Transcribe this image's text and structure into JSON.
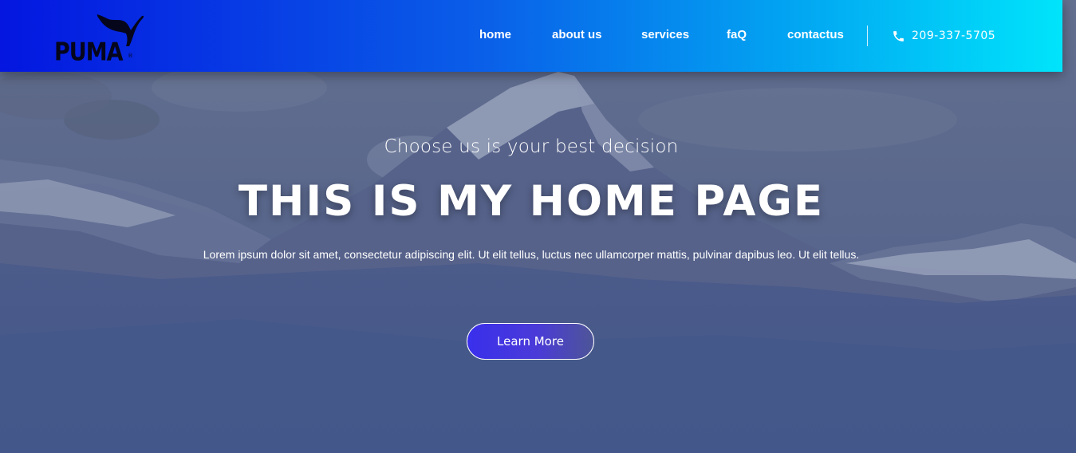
{
  "header": {
    "logo_text": "PUMA",
    "nav": [
      {
        "label": "home"
      },
      {
        "label": "about us"
      },
      {
        "label": "services"
      },
      {
        "label": "faQ"
      },
      {
        "label": "contactus"
      }
    ],
    "phone": {
      "icon": "phone-icon",
      "number": "209-337-5705"
    }
  },
  "hero": {
    "subtitle": "Choose us is your best decision",
    "title": "THIS IS MY HOME PAGE",
    "description": "Lorem ipsum dolor sit amet, consectetur adipiscing elit. Ut elit tellus, luctus nec ullamcorper mattis, pulvinar dapibus leo. Ut elit tellus.",
    "cta_label": "Learn More"
  },
  "colors": {
    "header_gradient_start": "#0416e0",
    "header_gradient_end": "#00e4fb",
    "hero_overlay": "#445888",
    "button_fill": "#3a2fec"
  }
}
